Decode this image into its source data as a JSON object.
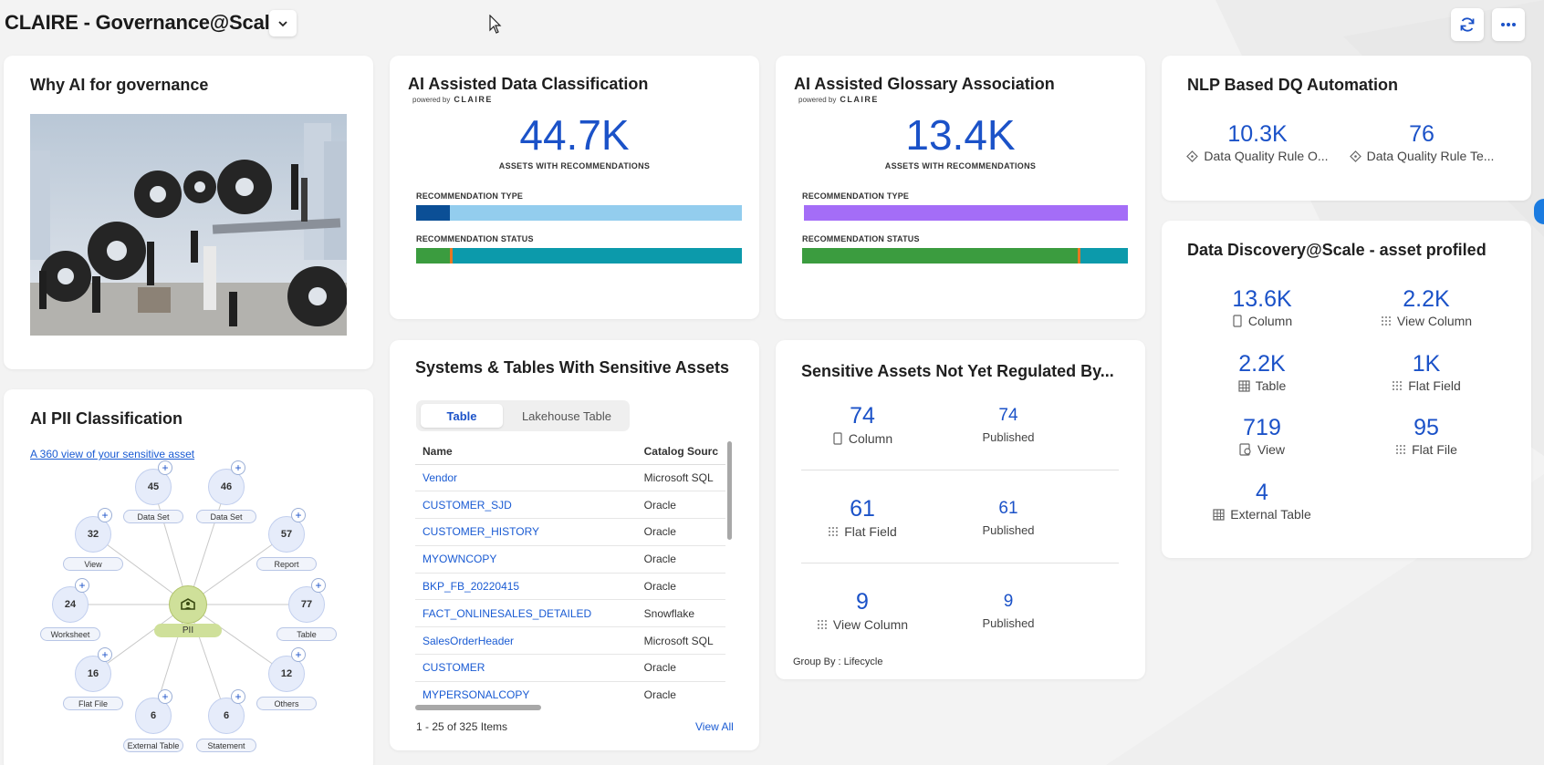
{
  "header": {
    "title": "CLAIRE - Governance@Scale"
  },
  "why_ai": {
    "title": "Why AI for governance"
  },
  "data_classification": {
    "title": "AI Assisted Data Classification",
    "powered_by": "powered by",
    "brand": "CLAIRE",
    "value": "44.7K",
    "label": "ASSETS WITH RECOMMENDATIONS",
    "type_label": "RECOMMENDATION TYPE",
    "status_label": "RECOMMENDATION STATUS",
    "type_bar": [
      {
        "pct": 10.5,
        "color": "#0b4f96"
      },
      {
        "pct": 89.5,
        "color": "#93cdee"
      }
    ],
    "status_bar": [
      {
        "pct": 10.5,
        "color": "#3b9c3f"
      },
      {
        "pct": 0.8,
        "color": "#e87722"
      },
      {
        "pct": 88.7,
        "color": "#0c9aab"
      }
    ]
  },
  "glossary_association": {
    "title": "AI Assisted Glossary Association",
    "powered_by": "powered by",
    "brand": "CLAIRE",
    "value": "13.4K",
    "label": "ASSETS WITH RECOMMENDATIONS",
    "type_label": "RECOMMENDATION TYPE",
    "status_label": "RECOMMENDATION STATUS",
    "type_bar": [
      {
        "pct": 100,
        "color": "#a46df7"
      }
    ],
    "status_bar": [
      {
        "pct": 84.5,
        "color": "#3b9c3f"
      },
      {
        "pct": 0.9,
        "color": "#e87722"
      },
      {
        "pct": 14.6,
        "color": "#0c9aab"
      }
    ]
  },
  "nlp_dq": {
    "title": "NLP Based DQ Automation",
    "stats": [
      {
        "value": "10.3K",
        "label": "Data Quality Rule O...",
        "icon": "diamond-icon"
      },
      {
        "value": "76",
        "label": "Data Quality Rule Te...",
        "icon": "diamond-icon"
      }
    ]
  },
  "discovery": {
    "title": "Data Discovery@Scale - asset profiled",
    "stats": [
      {
        "value": "13.6K",
        "label": "Column",
        "icon": "column-icon"
      },
      {
        "value": "2.2K",
        "label": "View Column",
        "icon": "dots-grid-icon"
      },
      {
        "value": "2.2K",
        "label": "Table",
        "icon": "table-icon"
      },
      {
        "value": "1K",
        "label": "Flat Field",
        "icon": "dots-grid-icon"
      },
      {
        "value": "719",
        "label": "View",
        "icon": "view-icon"
      },
      {
        "value": "95",
        "label": "Flat File",
        "icon": "dots-grid-icon"
      },
      {
        "value": "4",
        "label": "External Table",
        "icon": "table-icon"
      }
    ]
  },
  "pii": {
    "title": "AI PII Classification",
    "link": "A 360 view of your sensitive asset",
    "center_label": "PII",
    "nodes": [
      {
        "value": "45",
        "label": "Data Set"
      },
      {
        "value": "46",
        "label": "Data Set"
      },
      {
        "value": "57",
        "label": "Report"
      },
      {
        "value": "77",
        "label": "Table"
      },
      {
        "value": "12",
        "label": "Others"
      },
      {
        "value": "6",
        "label": "Statement"
      },
      {
        "value": "6",
        "label": "External Table"
      },
      {
        "value": "16",
        "label": "Flat File"
      },
      {
        "value": "24",
        "label": "Worksheet"
      },
      {
        "value": "32",
        "label": "View"
      }
    ]
  },
  "systems": {
    "title": "Systems & Tables With Sensitive Assets",
    "tabs": [
      "Table",
      "Lakehouse Table"
    ],
    "columns": [
      "Name",
      "Catalog Sourc"
    ],
    "rows": [
      [
        "Vendor",
        "Microsoft SQL"
      ],
      [
        "CUSTOMER_SJD",
        "Oracle"
      ],
      [
        "CUSTOMER_HISTORY",
        "Oracle"
      ],
      [
        "MYOWNCOPY",
        "Oracle"
      ],
      [
        "BKP_FB_20220415",
        "Oracle"
      ],
      [
        "FACT_ONLINESALES_DETAILED",
        "Snowflake"
      ],
      [
        "SalesOrderHeader",
        "Microsoft SQL"
      ],
      [
        "CUSTOMER",
        "Oracle"
      ],
      [
        "MYPERSONALCOPY",
        "Oracle"
      ]
    ],
    "pagination": "1 - 25 of 325 Items",
    "view_all": "View All"
  },
  "not_regulated": {
    "title": "Sensitive Assets Not Yet Regulated By...",
    "rows": [
      {
        "value": "74",
        "label": "Column",
        "icon": "column-icon",
        "published_value": "74",
        "published_label": "Published"
      },
      {
        "value": "61",
        "label": "Flat Field",
        "icon": "dots-grid-icon",
        "published_value": "61",
        "published_label": "Published"
      },
      {
        "value": "9",
        "label": "View Column",
        "icon": "dots-grid-icon",
        "published_value": "9",
        "published_label": "Published"
      }
    ],
    "group_by": "Group By : Lifecycle"
  },
  "colors": {
    "accent": "#1b52c8",
    "link": "#1a5bd3",
    "pii_center": "#cfe09a"
  }
}
